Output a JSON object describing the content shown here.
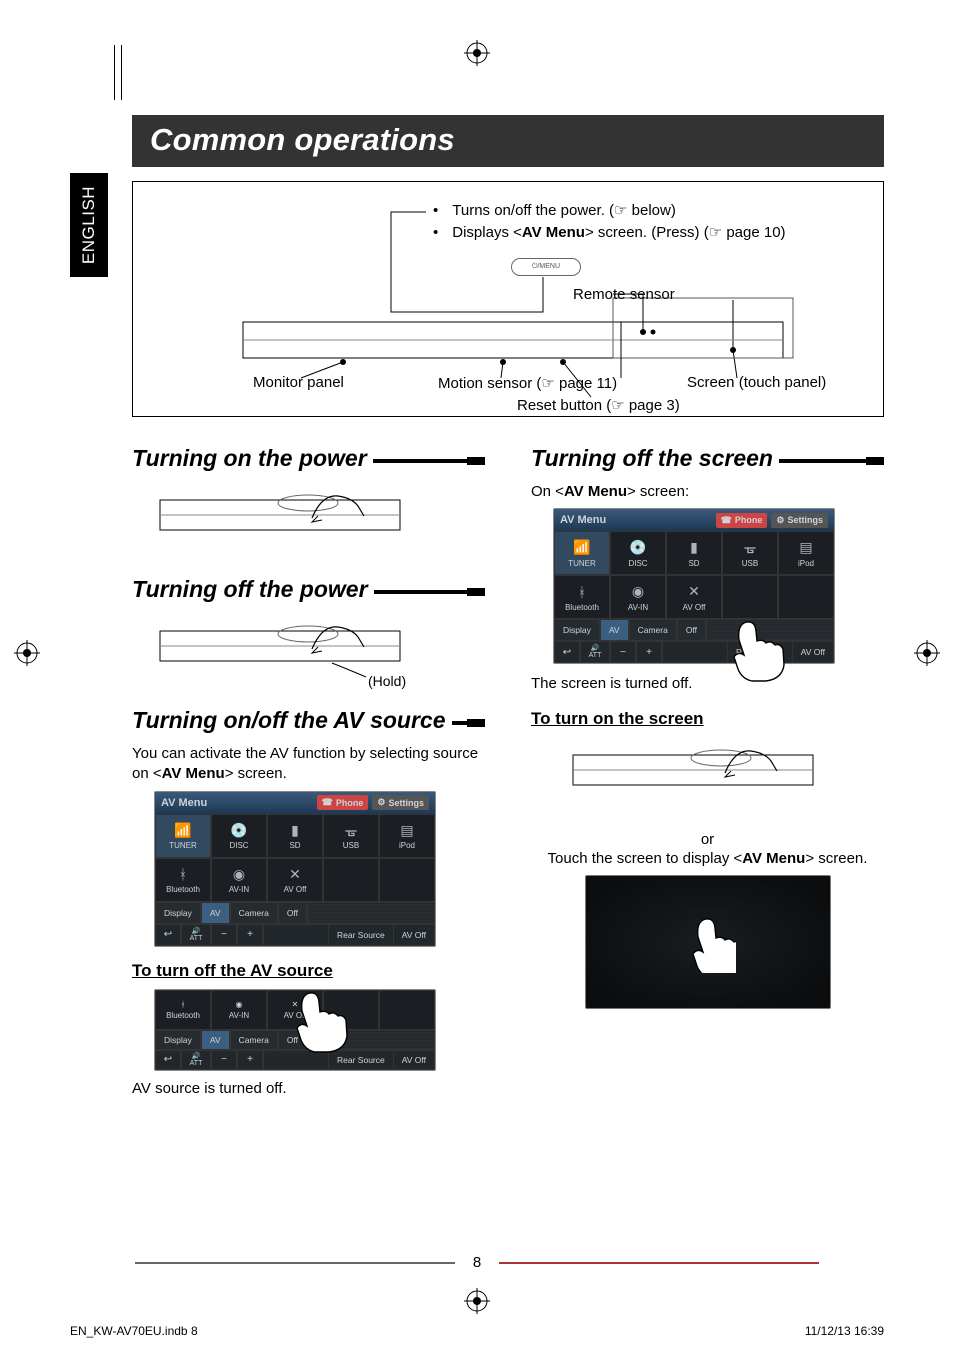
{
  "language_tab": "ENGLISH",
  "title": "Common operations",
  "device": {
    "bullets": [
      "Turns on/off the power. (☞ below)",
      "Displays <AV Menu> screen. (Press) (☞ page 10)"
    ],
    "menu_button_label": "⏻/MENU",
    "remote_sensor": "Remote sensor",
    "monitor_panel": "Monitor panel",
    "motion_sensor": "Motion sensor (☞ page 11)",
    "reset_button": "Reset button (☞ page 3)",
    "screen_touch": "Screen (touch panel)"
  },
  "left": {
    "h_on": "Turning on the power",
    "h_off": "Turning off the power",
    "hold": "(Hold)",
    "h_avsrc": "Turning on/off the AV source",
    "avsrc_body_1": "You can activate the AV function by selecting source on <",
    "avsrc_body_bold": "AV Menu",
    "avsrc_body_2": "> screen.",
    "h_turnoff_src": "To turn off the AV source",
    "src_off_text": "AV source is turned off."
  },
  "right": {
    "h_screenoff": "Turning off the screen",
    "on_menu_1": "On <",
    "on_menu_b": "AV Menu",
    "on_menu_2": "> screen:",
    "screen_off_text": "The screen is turned off.",
    "h_turnon": "To turn on the screen",
    "or": "or",
    "touch_1": "Touch the screen to display <",
    "touch_b": "AV Menu",
    "touch_2": "> screen."
  },
  "av_menu": {
    "title": "AV Menu",
    "phone": "Phone",
    "settings": "Settings",
    "sources": [
      "TUNER",
      "DISC",
      "SD",
      "USB",
      "iPod",
      "Bluetooth",
      "AV-IN",
      "AV Off"
    ],
    "display_row": {
      "label": "Display",
      "tabs": [
        "AV",
        "Camera",
        "Off"
      ]
    },
    "footer": {
      "back": "↩",
      "att": "ATT",
      "minus": "−",
      "plus": "+",
      "rear": "Rear Source",
      "avoff": "AV Off"
    }
  },
  "icons": {
    "tuner": "📶",
    "disc": "💿",
    "sd": "▮",
    "usb": "ᚗ",
    "ipod": "▤",
    "bt": "ᚼ",
    "avin": "◉",
    "avoff": "✕",
    "phone": "☎",
    "gear": "⚙",
    "sound": "🔊"
  },
  "page_number": "8",
  "footer_meta": {
    "left": "EN_KW-AV70EU.indb   8",
    "right": "11/12/13   16:39"
  }
}
